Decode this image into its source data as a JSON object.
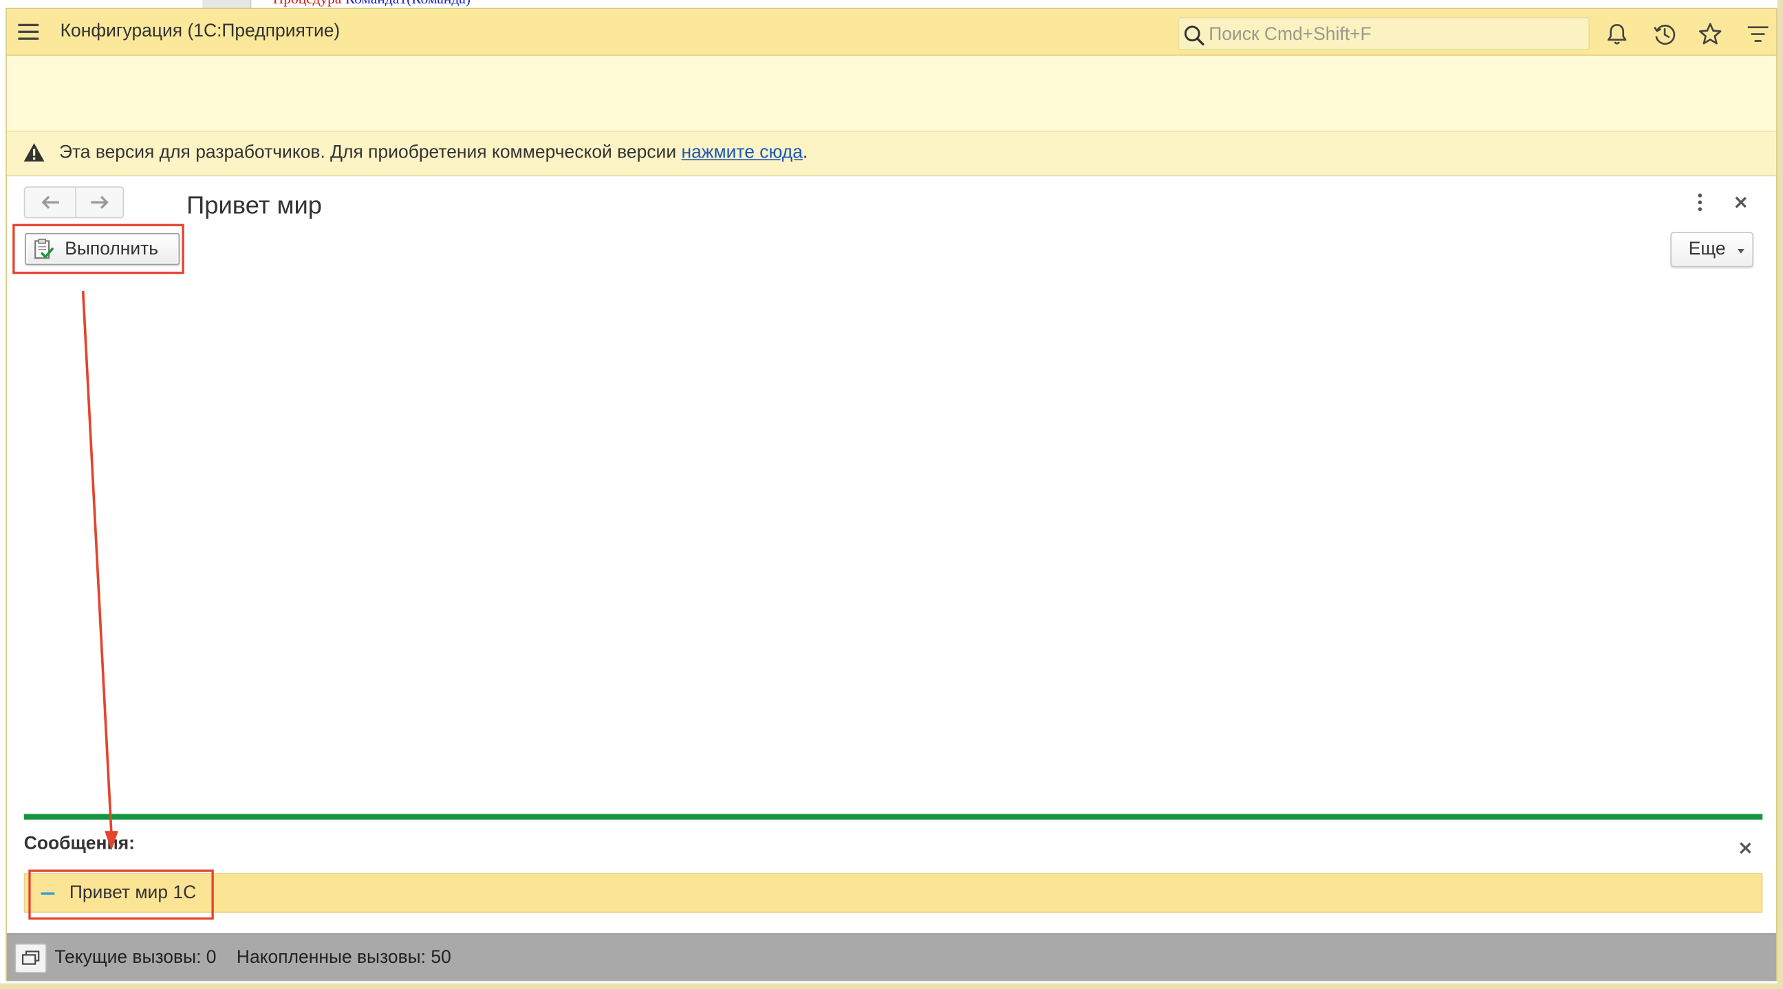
{
  "background_window": {
    "code_keyword": "Процедура",
    "code_rest": "Команда1(Команда)"
  },
  "app": {
    "title": "Конфигурация  (1С:Предприятие)",
    "search_placeholder": "Поиск Cmd+Shift+F",
    "toolbar_icons": [
      "bell-icon",
      "history-icon",
      "star-icon",
      "menu-list-icon"
    ]
  },
  "warning": {
    "text": "Эта версия для разработчиков. Для приобретения коммерческой версии ",
    "link": "нажмите сюда",
    "suffix": "."
  },
  "form": {
    "title": "Привет мир",
    "run_button": "Выполнить",
    "more_button": "Еще"
  },
  "messages": {
    "header": "Сообщения:",
    "items": [
      "Привет мир 1С"
    ]
  },
  "status": {
    "text": "Текущие вызовы: 0    Накопленные вызовы: 50"
  },
  "colors": {
    "titlebar": "#fbe89b",
    "accent_green": "#169542",
    "annotation_red": "#e4432e",
    "message_row": "#fce495",
    "link": "#1b56b8"
  }
}
